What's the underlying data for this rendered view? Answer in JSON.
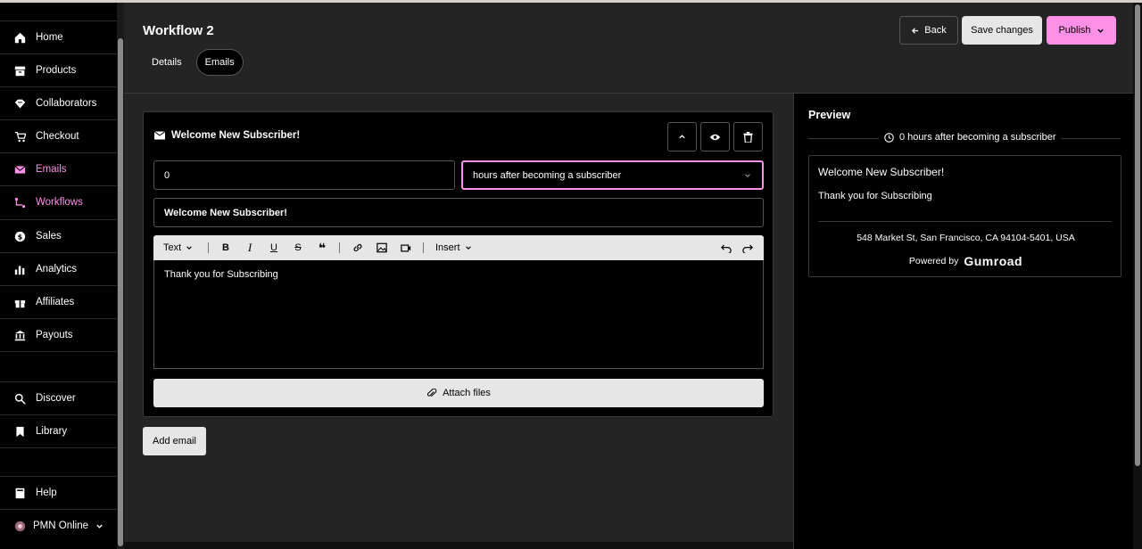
{
  "sidebar": {
    "items": [
      {
        "label": "Home",
        "icon": "home-icon"
      },
      {
        "label": "Products",
        "icon": "archive-icon"
      },
      {
        "label": "Collaborators",
        "icon": "handshake-icon"
      },
      {
        "label": "Checkout",
        "icon": "cart-icon"
      },
      {
        "label": "Emails",
        "icon": "envelope-icon",
        "active": true
      },
      {
        "label": "Workflows",
        "icon": "workflow-icon",
        "active": true
      },
      {
        "label": "Sales",
        "icon": "dollar-circle-icon"
      },
      {
        "label": "Analytics",
        "icon": "bar-chart-icon"
      },
      {
        "label": "Affiliates",
        "icon": "gift-icon"
      },
      {
        "label": "Payouts",
        "icon": "bank-icon"
      },
      {
        "label": "Discover",
        "icon": "search-icon"
      },
      {
        "label": "Library",
        "icon": "bookmark-icon"
      },
      {
        "label": "Help",
        "icon": "book-icon"
      }
    ],
    "account": {
      "label": "PMN Online"
    }
  },
  "header": {
    "title": "Workflow 2",
    "tabs": [
      {
        "label": "Details"
      },
      {
        "label": "Emails",
        "active": true
      }
    ],
    "back_label": "Back",
    "save_label": "Save changes",
    "publish_label": "Publish"
  },
  "email": {
    "title": "Welcome New Subscriber!",
    "delay_value": "0",
    "delay_unit": "hours after becoming a subscriber",
    "subject": "Welcome New Subscriber!",
    "toolbar": {
      "text_style": "Text",
      "insert_label": "Insert"
    },
    "body": "Thank you for Subscribing",
    "attach_label": "Attach files"
  },
  "add_email_label": "Add email",
  "preview": {
    "title": "Preview",
    "schedule": "0 hours after becoming a subscriber",
    "subject": "Welcome New Subscriber!",
    "body": "Thank you for Subscribing",
    "address": "548 Market St, San Francisco, CA 94104-5401, USA",
    "powered_by": "Powered by",
    "logo_text": "Gumroad"
  },
  "colors": {
    "accent": "#ff90e8",
    "panel": "#242424",
    "background": "#000000"
  }
}
